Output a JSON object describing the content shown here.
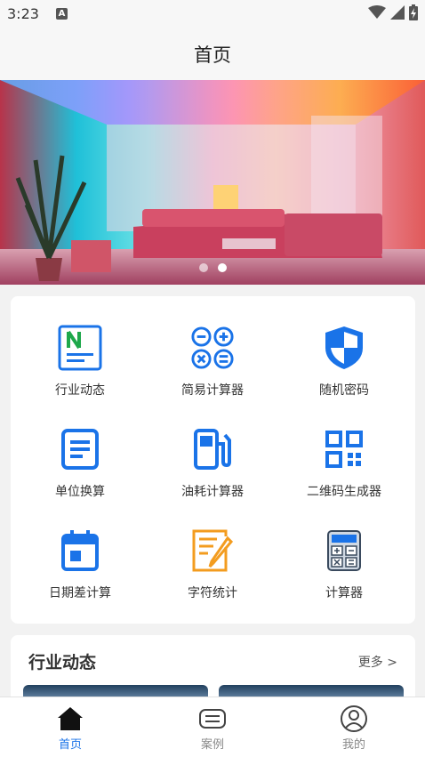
{
  "status": {
    "time": "3:23",
    "notification_icon": "A"
  },
  "header": {
    "title": "首页"
  },
  "banner": {
    "slide_count": 2,
    "active_slide": 2
  },
  "tools": [
    {
      "label": "行业动态",
      "icon": "news-icon",
      "color": "#1a73e8"
    },
    {
      "label": "简易计算器",
      "icon": "calculator-operators-icon",
      "color": "#1a73e8"
    },
    {
      "label": "随机密码",
      "icon": "shield-icon",
      "color": "#1a73e8"
    },
    {
      "label": "单位换算",
      "icon": "document-icon",
      "color": "#1a73e8"
    },
    {
      "label": "油耗计算器",
      "icon": "fuel-pump-icon",
      "color": "#1a73e8"
    },
    {
      "label": "二维码生成器",
      "icon": "qr-code-icon",
      "color": "#1a73e8"
    },
    {
      "label": "日期差计算",
      "icon": "calendar-icon",
      "color": "#1a73e8"
    },
    {
      "label": "字符统计",
      "icon": "edit-document-icon",
      "color": "#f39c1f"
    },
    {
      "label": "计算器",
      "icon": "calculator-icon",
      "color": "#1a73e8"
    }
  ],
  "news": {
    "title": "行业动态",
    "more": "更多 >"
  },
  "nav": {
    "items": [
      {
        "label": "首页",
        "icon": "home-icon",
        "active": true
      },
      {
        "label": "案例",
        "icon": "message-icon",
        "active": false
      },
      {
        "label": "我的",
        "icon": "user-icon",
        "active": false
      }
    ]
  },
  "colors": {
    "accent": "#1a73e8",
    "orange": "#f39c1f",
    "background": "#f2f2f2"
  }
}
